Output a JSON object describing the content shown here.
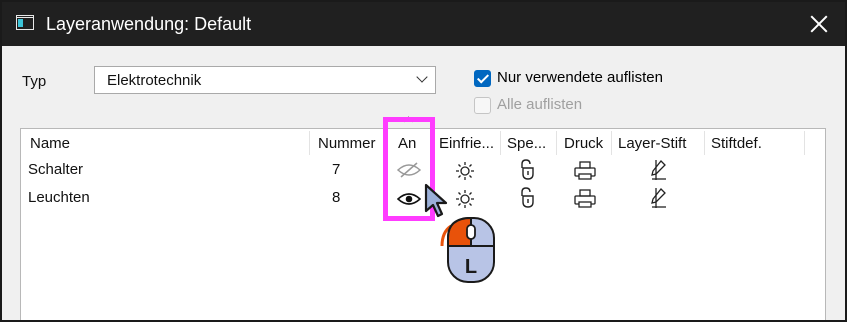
{
  "window": {
    "title": "Layeranwendung: Default",
    "app_icon": "layer-app-icon",
    "close_icon": "close-icon"
  },
  "filter": {
    "type_label": "Typ",
    "type_value": "Elektrotechnik",
    "only_used_label": "Nur verwendete auflisten",
    "only_used_checked": true,
    "all_label": "Alle auflisten",
    "all_checked": false,
    "all_enabled": false
  },
  "table": {
    "columns": [
      "Name",
      "Nummer",
      "An",
      "Einfrie...",
      "Spe...",
      "Druck",
      "Layer-Stift",
      "Stiftdef."
    ],
    "sorted_column": "An",
    "rows": [
      {
        "name": "Schalter",
        "number": "7",
        "on": false,
        "freeze": "sun-icon",
        "lock": "unlocked-icon",
        "print": "printer-icon",
        "pen": "no-pen-icon"
      },
      {
        "name": "Leuchten",
        "number": "8",
        "on": true,
        "freeze": "sun-icon",
        "lock": "unlocked-icon",
        "print": "printer-icon",
        "pen": "no-pen-icon"
      }
    ]
  },
  "overlay": {
    "highlight_color": "#ff3cff",
    "cursor_icon": "arrow-cursor-icon",
    "mouse_icon": "mouse-left-click-icon",
    "mouse_letter": "L"
  },
  "colors": {
    "titlebar": "#202020",
    "accent": "#0067c0",
    "mouse_orange": "#e8520a"
  }
}
